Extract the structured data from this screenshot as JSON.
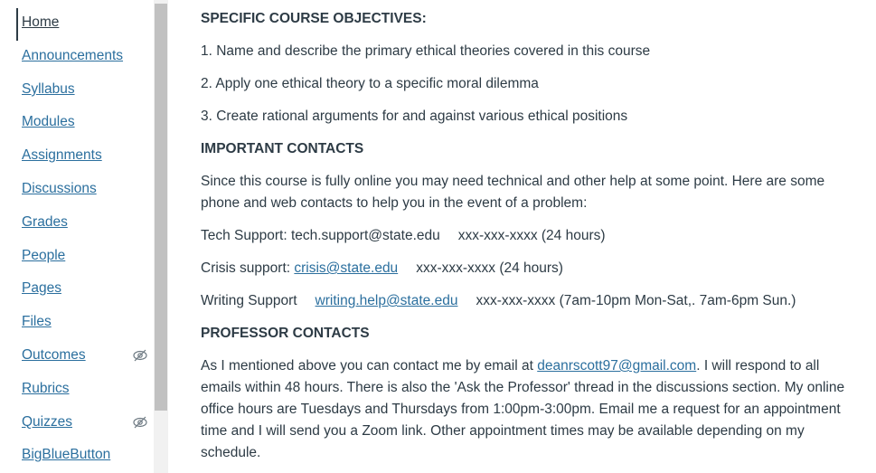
{
  "sidebar": {
    "items": [
      {
        "label": "Home"
      },
      {
        "label": "Announcements"
      },
      {
        "label": "Syllabus"
      },
      {
        "label": "Modules"
      },
      {
        "label": "Assignments"
      },
      {
        "label": "Discussions"
      },
      {
        "label": "Grades"
      },
      {
        "label": "People"
      },
      {
        "label": "Pages"
      },
      {
        "label": "Files"
      },
      {
        "label": "Outcomes",
        "icon": "eye-slash-icon"
      },
      {
        "label": "Rubrics"
      },
      {
        "label": "Quizzes",
        "icon": "eye-slash-icon"
      },
      {
        "label": "BigBlueButton"
      }
    ]
  },
  "content": {
    "objectives_heading": "SPECIFIC COURSE OBJECTIVES:",
    "objective_1": "1. Name and describe the primary ethical theories covered in this course",
    "objective_2": "2. Apply one ethical theory to a specific moral dilemma",
    "objective_3": "3. Create rational arguments for and against various ethical positions",
    "contacts_heading": "IMPORTANT CONTACTS",
    "contacts_intro": "Since this course is fully online you may need technical and other help at some point. Here are some phone and web contacts to help you in the event of a problem:",
    "tech_label": "Tech Support: tech.support@state.edu",
    "tech_phone": "xxx-xxx-xxxx (24 hours)",
    "crisis_label": "Crisis support: ",
    "crisis_email": "crisis@state.edu",
    "crisis_phone": "xxx-xxx-xxxx (24 hours)",
    "writing_label": "Writing Support",
    "writing_email": "writing.help@state.edu",
    "writing_phone": "xxx-xxx-xxxx (7am-10pm Mon-Sat,. 7am-6pm Sun.)",
    "professor_heading": "PROFESSOR CONTACTS",
    "professor_text_1": "As I mentioned above you can contact me by email at ",
    "professor_email": "deanrscott97@gmail.com",
    "professor_text_2": ". I will respond to all emails within 48 hours. There is also the 'Ask the Professor' thread in the discussions section. My online office hours are Tuesdays and Thursdays from 1:00pm-3:00pm. Email me a request for an appointment time and I will send you a Zoom link. Other appointment times may be available depending on my schedule."
  },
  "colors": {
    "link": "#2b6f9e",
    "text": "#2d3b45",
    "scrollbar_thumb": "#c1c1c1"
  }
}
